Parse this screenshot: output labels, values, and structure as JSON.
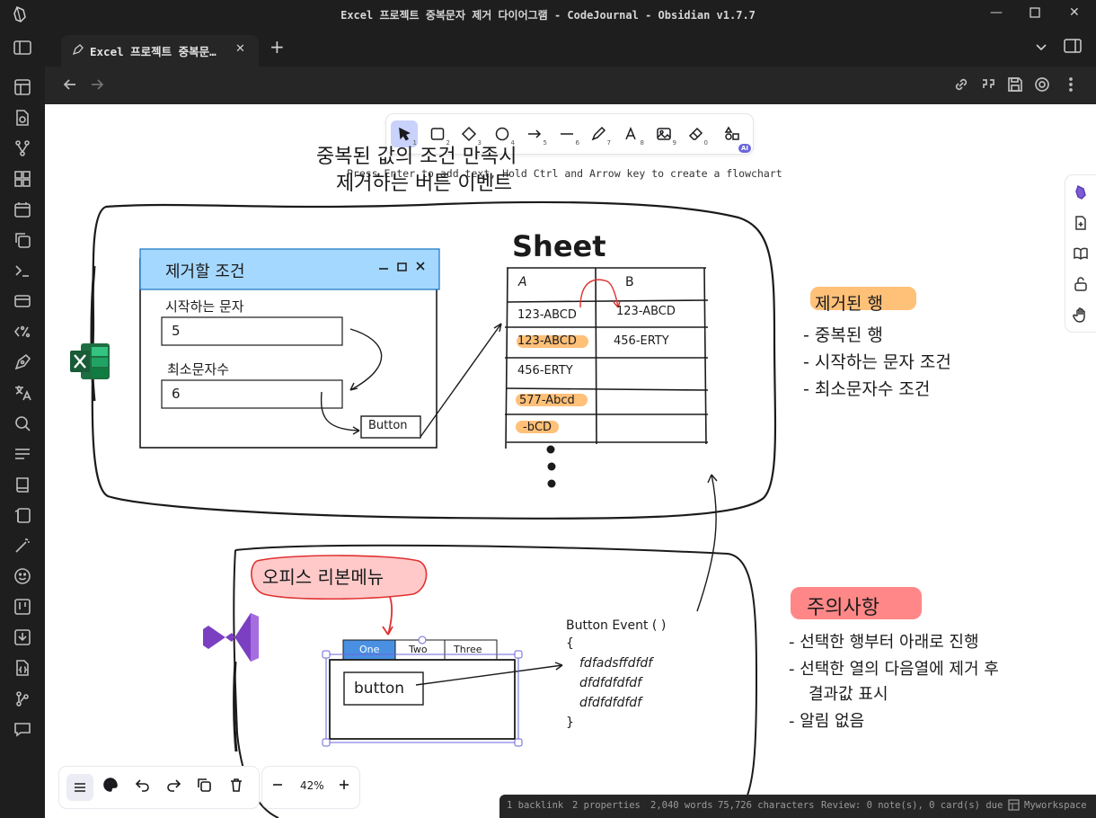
{
  "window": {
    "title": "Excel 프로젝트 중복문자 제거 다이어그램 - CodeJournal - Obsidian v1.7.7"
  },
  "tab": {
    "label": "Excel 프로젝트 중복문…"
  },
  "toolbar": {
    "tools": [
      {
        "name": "selection",
        "key": "1"
      },
      {
        "name": "rectangle",
        "key": "2"
      },
      {
        "name": "diamond",
        "key": "3"
      },
      {
        "name": "ellipse",
        "key": "4"
      },
      {
        "name": "arrow",
        "key": "5"
      },
      {
        "name": "line",
        "key": "6"
      },
      {
        "name": "draw",
        "key": "7"
      },
      {
        "name": "text",
        "key": "8"
      },
      {
        "name": "image",
        "key": "9"
      },
      {
        "name": "eraser",
        "key": "0"
      }
    ],
    "ai_badge": "AI",
    "hint": "Press Enter to add text, Hold Ctrl and Arrow key to create a flowchart"
  },
  "diagram": {
    "title_line1": "중복된 값의 조건 만족시",
    "title_line2": "제거하는 버튼 이벤트",
    "form_title": "제거할 조건",
    "form_label1": "시작하는 문자",
    "form_value1": "5",
    "form_label2": "최소문자수",
    "form_value2": "6",
    "form_button": "Button",
    "sheet_title": "Sheet",
    "sheet_col_a": "A",
    "sheet_col_b": "B",
    "sheet_rows": [
      {
        "a": "123-ABCD",
        "b": "123-ABCD"
      },
      {
        "a": "123-ABCD",
        "b": "456-ERTY"
      },
      {
        "a": "456-ERTY",
        "b": ""
      },
      {
        "a": "577-Abcd",
        "b": ""
      },
      {
        "a": "-bCD",
        "b": ""
      }
    ],
    "removed_title": "제거된 행",
    "removed_items": [
      "- 중복된 행",
      "- 시작하는 문자 조건",
      "- 최소문자수 조건"
    ],
    "ribbon_bubble": "오피스 리본메뉴",
    "ribbon_tabs": [
      "One",
      "Two",
      "Three"
    ],
    "ribbon_button": "button",
    "event_lines": [
      "Button Event ( )",
      "{",
      "fdfadsffdfdf",
      "dfdfdfdfdf",
      "dfdfdfdfdf",
      "}"
    ],
    "notes_title": "주의사항",
    "notes_items": [
      "- 선택한 행부터 아래로 진행",
      "- 선택한 열의 다음열에 제거 후",
      "결과값 표시",
      "- 알림 없음"
    ]
  },
  "zoom": {
    "value": "42%"
  },
  "status": {
    "backlinks": "1 backlink",
    "properties": "2 properties",
    "words": "2,040 words",
    "characters": "75,726 characters",
    "review": "Review: 0 note(s), 0 card(s) due",
    "workspace": "Myworkspace"
  },
  "colors": {
    "selected_tool": "#c9d2fb",
    "form_header": "#a5d8ff",
    "highlight_orange": "#ffc078",
    "highlight_red": "#ff8787",
    "excel_green": "#1d6f42",
    "vs_purple": "#7b3fc1"
  }
}
